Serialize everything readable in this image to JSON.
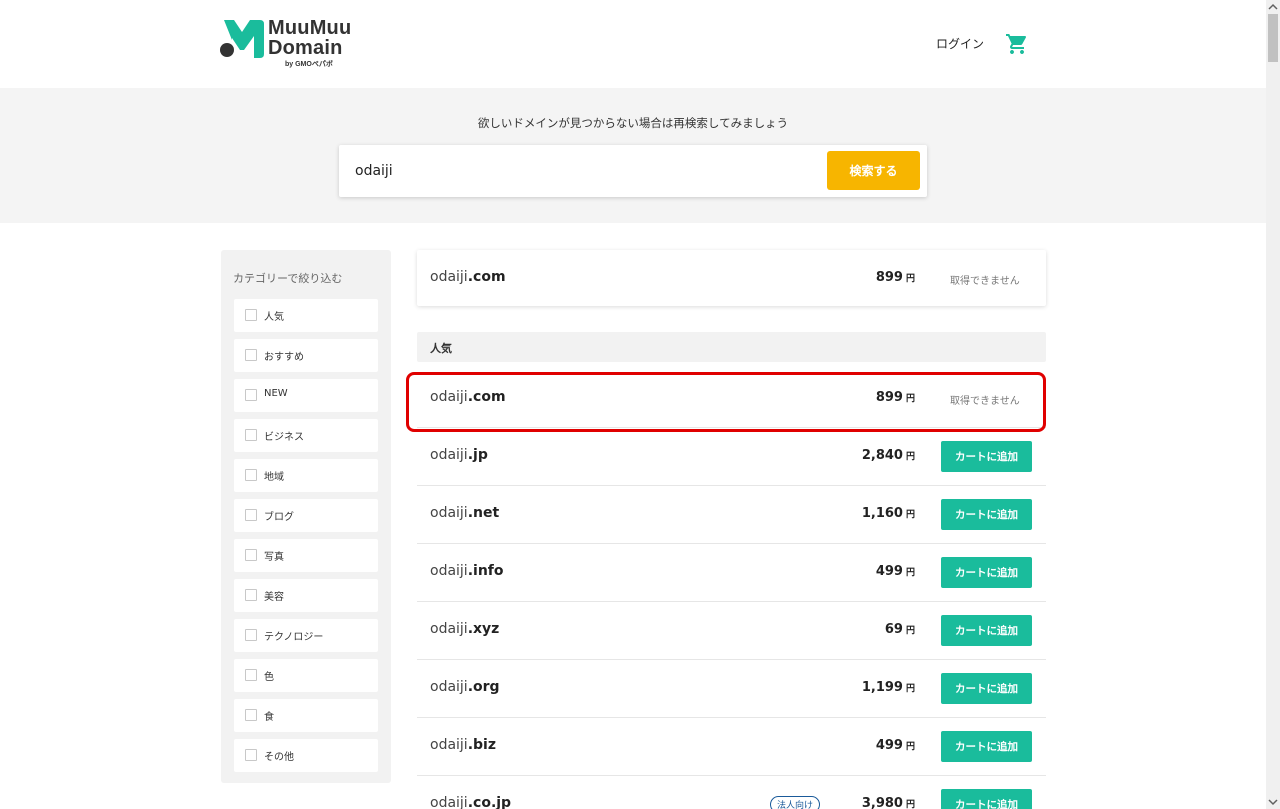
{
  "header": {
    "logo_line1": "MuuMuu",
    "logo_line2": "Domain",
    "logo_by": "by GMOペパボ",
    "login_label": "ログイン",
    "cart_icon": "cart-icon",
    "brand_color": "#1abc9c"
  },
  "search": {
    "hint": "欲しいドメインが見つからない場合は再検索してみましょう",
    "value": "odaiji",
    "button_label": "検索する",
    "button_color": "#f7b500"
  },
  "sidebar": {
    "title": "カテゴリーで絞り込む",
    "items": [
      {
        "label": "人気"
      },
      {
        "label": "おすすめ"
      },
      {
        "label": "NEW"
      },
      {
        "label": "ビジネス"
      },
      {
        "label": "地域"
      },
      {
        "label": "ブログ"
      },
      {
        "label": "写真"
      },
      {
        "label": "美容"
      },
      {
        "label": "テクノロジー"
      },
      {
        "label": "色"
      },
      {
        "label": "食"
      },
      {
        "label": "その他"
      }
    ]
  },
  "top_result": {
    "name": "odaiji",
    "tld": ".com",
    "price": "899",
    "yen": "円",
    "status": "取得できません"
  },
  "section": {
    "title": "人気"
  },
  "results": [
    {
      "name": "odaiji",
      "tld": ".com",
      "price": "899",
      "yen": "円",
      "status": "取得できません",
      "available": false
    },
    {
      "name": "odaiji",
      "tld": ".jp",
      "price": "2,840",
      "yen": "円",
      "action": "カートに追加",
      "available": true
    },
    {
      "name": "odaiji",
      "tld": ".net",
      "price": "1,160",
      "yen": "円",
      "action": "カートに追加",
      "available": true
    },
    {
      "name": "odaiji",
      "tld": ".info",
      "price": "499",
      "yen": "円",
      "action": "カートに追加",
      "available": true
    },
    {
      "name": "odaiji",
      "tld": ".xyz",
      "price": "69",
      "yen": "円",
      "action": "カートに追加",
      "available": true
    },
    {
      "name": "odaiji",
      "tld": ".org",
      "price": "1,199",
      "yen": "円",
      "action": "カートに追加",
      "available": true
    },
    {
      "name": "odaiji",
      "tld": ".biz",
      "price": "499",
      "yen": "円",
      "action": "カートに追加",
      "available": true
    },
    {
      "name": "odaiji",
      "tld": ".co.jp",
      "price": "3,980",
      "yen": "円",
      "action": "カートに追加",
      "available": true,
      "badge": "法人向け"
    }
  ],
  "highlight_color": "#e00000"
}
